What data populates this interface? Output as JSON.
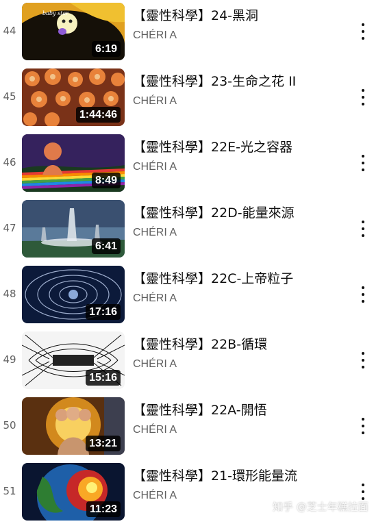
{
  "playlist": {
    "items": [
      {
        "index": "44",
        "title": "【靈性科學】24-黑洞",
        "channel": "CHÉRI A",
        "duration": "6:19"
      },
      {
        "index": "45",
        "title": "【靈性科學】23-生命之花 II",
        "channel": "CHÉRI A",
        "duration": "1:44:46"
      },
      {
        "index": "46",
        "title": "【靈性科學】22E-光之容器",
        "channel": "CHÉRI A",
        "duration": "8:49"
      },
      {
        "index": "47",
        "title": "【靈性科學】22D-能量來源",
        "channel": "CHÉRI A",
        "duration": "6:41"
      },
      {
        "index": "48",
        "title": "【靈性科學】22C-上帝粒子",
        "channel": "CHÉRI A",
        "duration": "17:16"
      },
      {
        "index": "49",
        "title": "【靈性科學】22B-循環",
        "channel": "CHÉRI A",
        "duration": "15:16"
      },
      {
        "index": "50",
        "title": "【靈性科學】22A-開悟",
        "channel": "CHÉRI A",
        "duration": "13:21"
      },
      {
        "index": "51",
        "title": "【靈性科學】21-環形能量流",
        "channel": "CHÉRI A",
        "duration": "11:23"
      }
    ]
  },
  "watermark": "知乎 @芝士年糕拉面",
  "icons": {
    "more": "more-vert-icon"
  },
  "colors": {
    "text_primary": "#0f0f0f",
    "text_secondary": "#606060",
    "duration_bg": "#000000"
  }
}
